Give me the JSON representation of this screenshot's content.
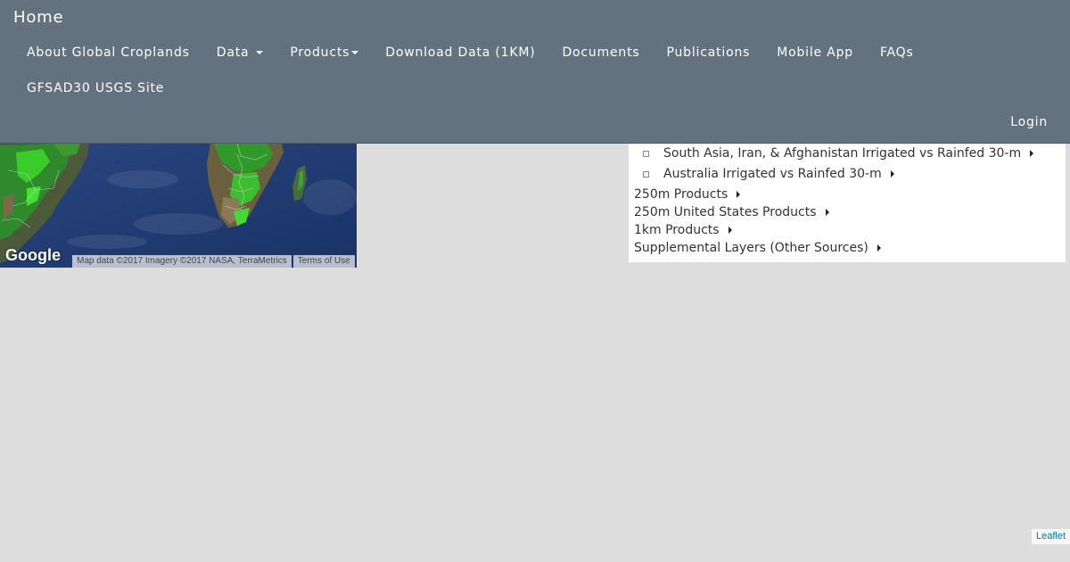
{
  "navbar": {
    "brand": "Home",
    "row1": [
      {
        "label": "About Global Croplands",
        "dropdown": false
      },
      {
        "label": "Data",
        "dropdown": true
      },
      {
        "label": "Products",
        "dropdown": true
      },
      {
        "label": "Download Data (1KM)",
        "dropdown": false
      },
      {
        "label": "Documents",
        "dropdown": false
      },
      {
        "label": "Publications",
        "dropdown": false
      },
      {
        "label": "Mobile App",
        "dropdown": false
      },
      {
        "label": "FAQs",
        "dropdown": false
      }
    ],
    "row2": [
      {
        "label": "GFSAD30 USGS Site",
        "dropdown": false
      }
    ],
    "login": "Login",
    "color": "#64727f"
  },
  "map": {
    "google_logo": "Google",
    "attribution": "Map data ©2017 Imagery ©2017 NASA, TerraMetrics",
    "terms": "Terms of Use"
  },
  "layers": {
    "items": [
      {
        "label": "South Asia, Iran, & Afghanistan Irrigated vs Rainfed 30-m",
        "checked": false
      },
      {
        "label": "Australia Irrigated vs Rainfed 30-m",
        "checked": false
      }
    ],
    "groups": [
      {
        "label": "250m Products"
      },
      {
        "label": "250m United States Products"
      },
      {
        "label": "1km Products"
      },
      {
        "label": "Supplemental Layers (Other Sources)"
      }
    ]
  },
  "leaflet": {
    "label": "Leaflet",
    "color": "#0078a8"
  }
}
